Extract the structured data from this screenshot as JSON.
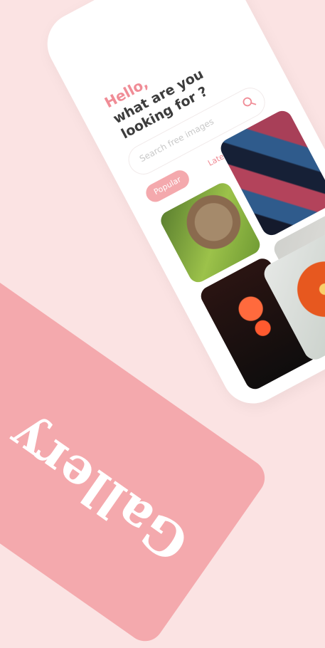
{
  "greeting": {
    "hello": "Hello,",
    "line1": "what are you",
    "line2": "looking for ?"
  },
  "search": {
    "placeholder": "Search free images"
  },
  "tabs": [
    {
      "label": "Popular"
    },
    {
      "label": "Latest"
    }
  ],
  "gallery_title": "Gallery",
  "colors": {
    "accent_pink": "#f4a9ad",
    "background": "#fbe3e3"
  }
}
